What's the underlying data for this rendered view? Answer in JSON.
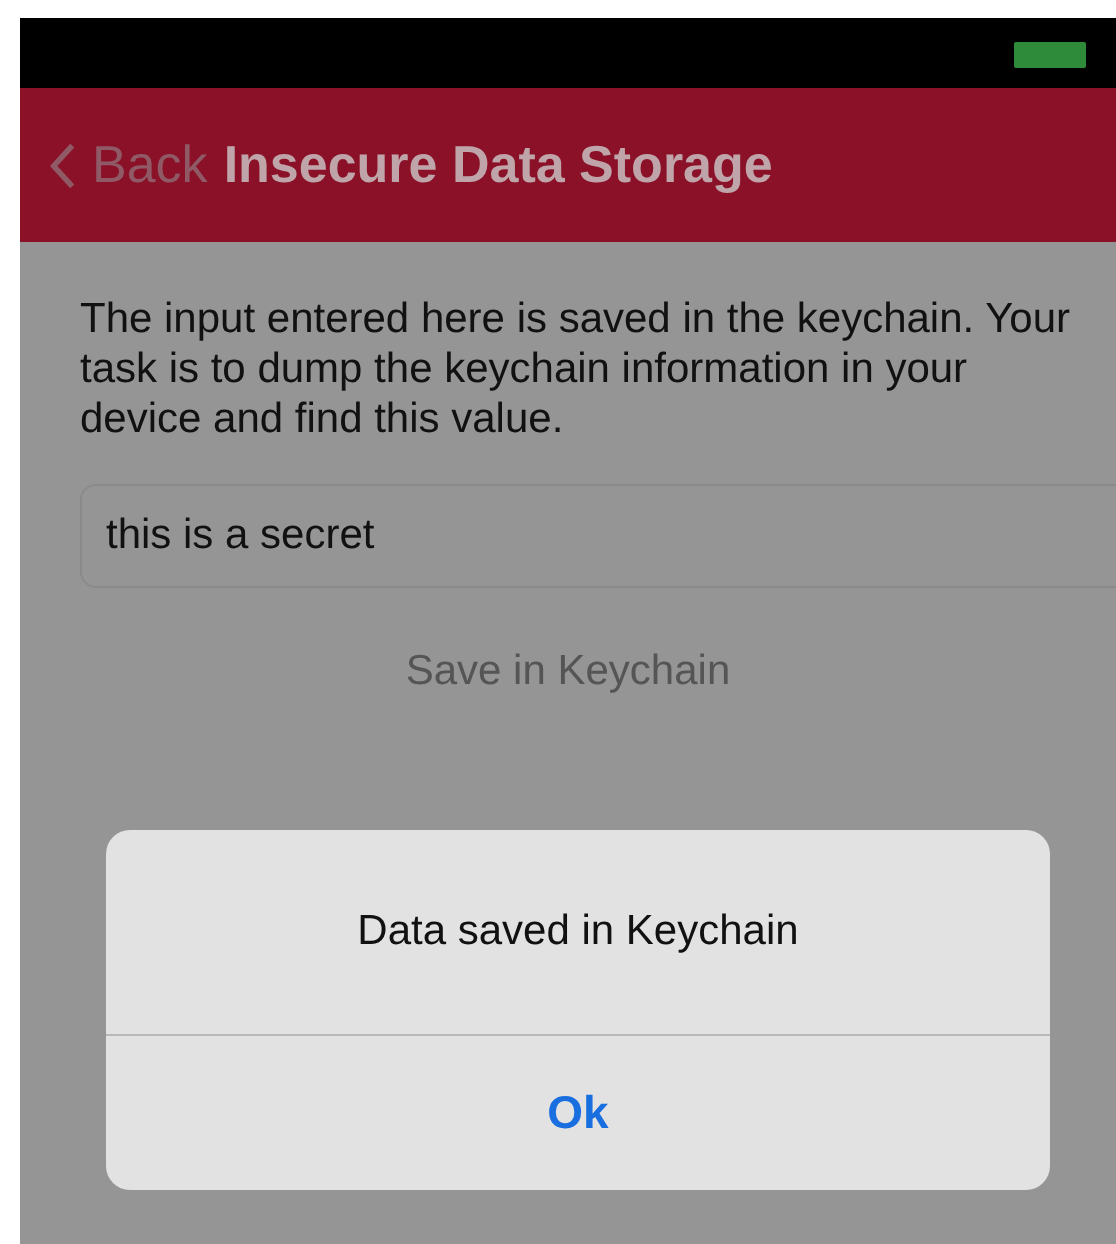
{
  "nav_bar": {
    "back": "Back",
    "title": "Insecure Data Storage"
  },
  "content": {
    "description": "The input entered here is saved in the keychain. Your task is to dump the keychain information in your device and find this value.",
    "input": {
      "value": "this is a secret"
    },
    "save_button": "Save in Keychain"
  },
  "alert": {
    "message": "Data saved in Keychain",
    "buttons": [
      "Ok"
    ]
  }
}
